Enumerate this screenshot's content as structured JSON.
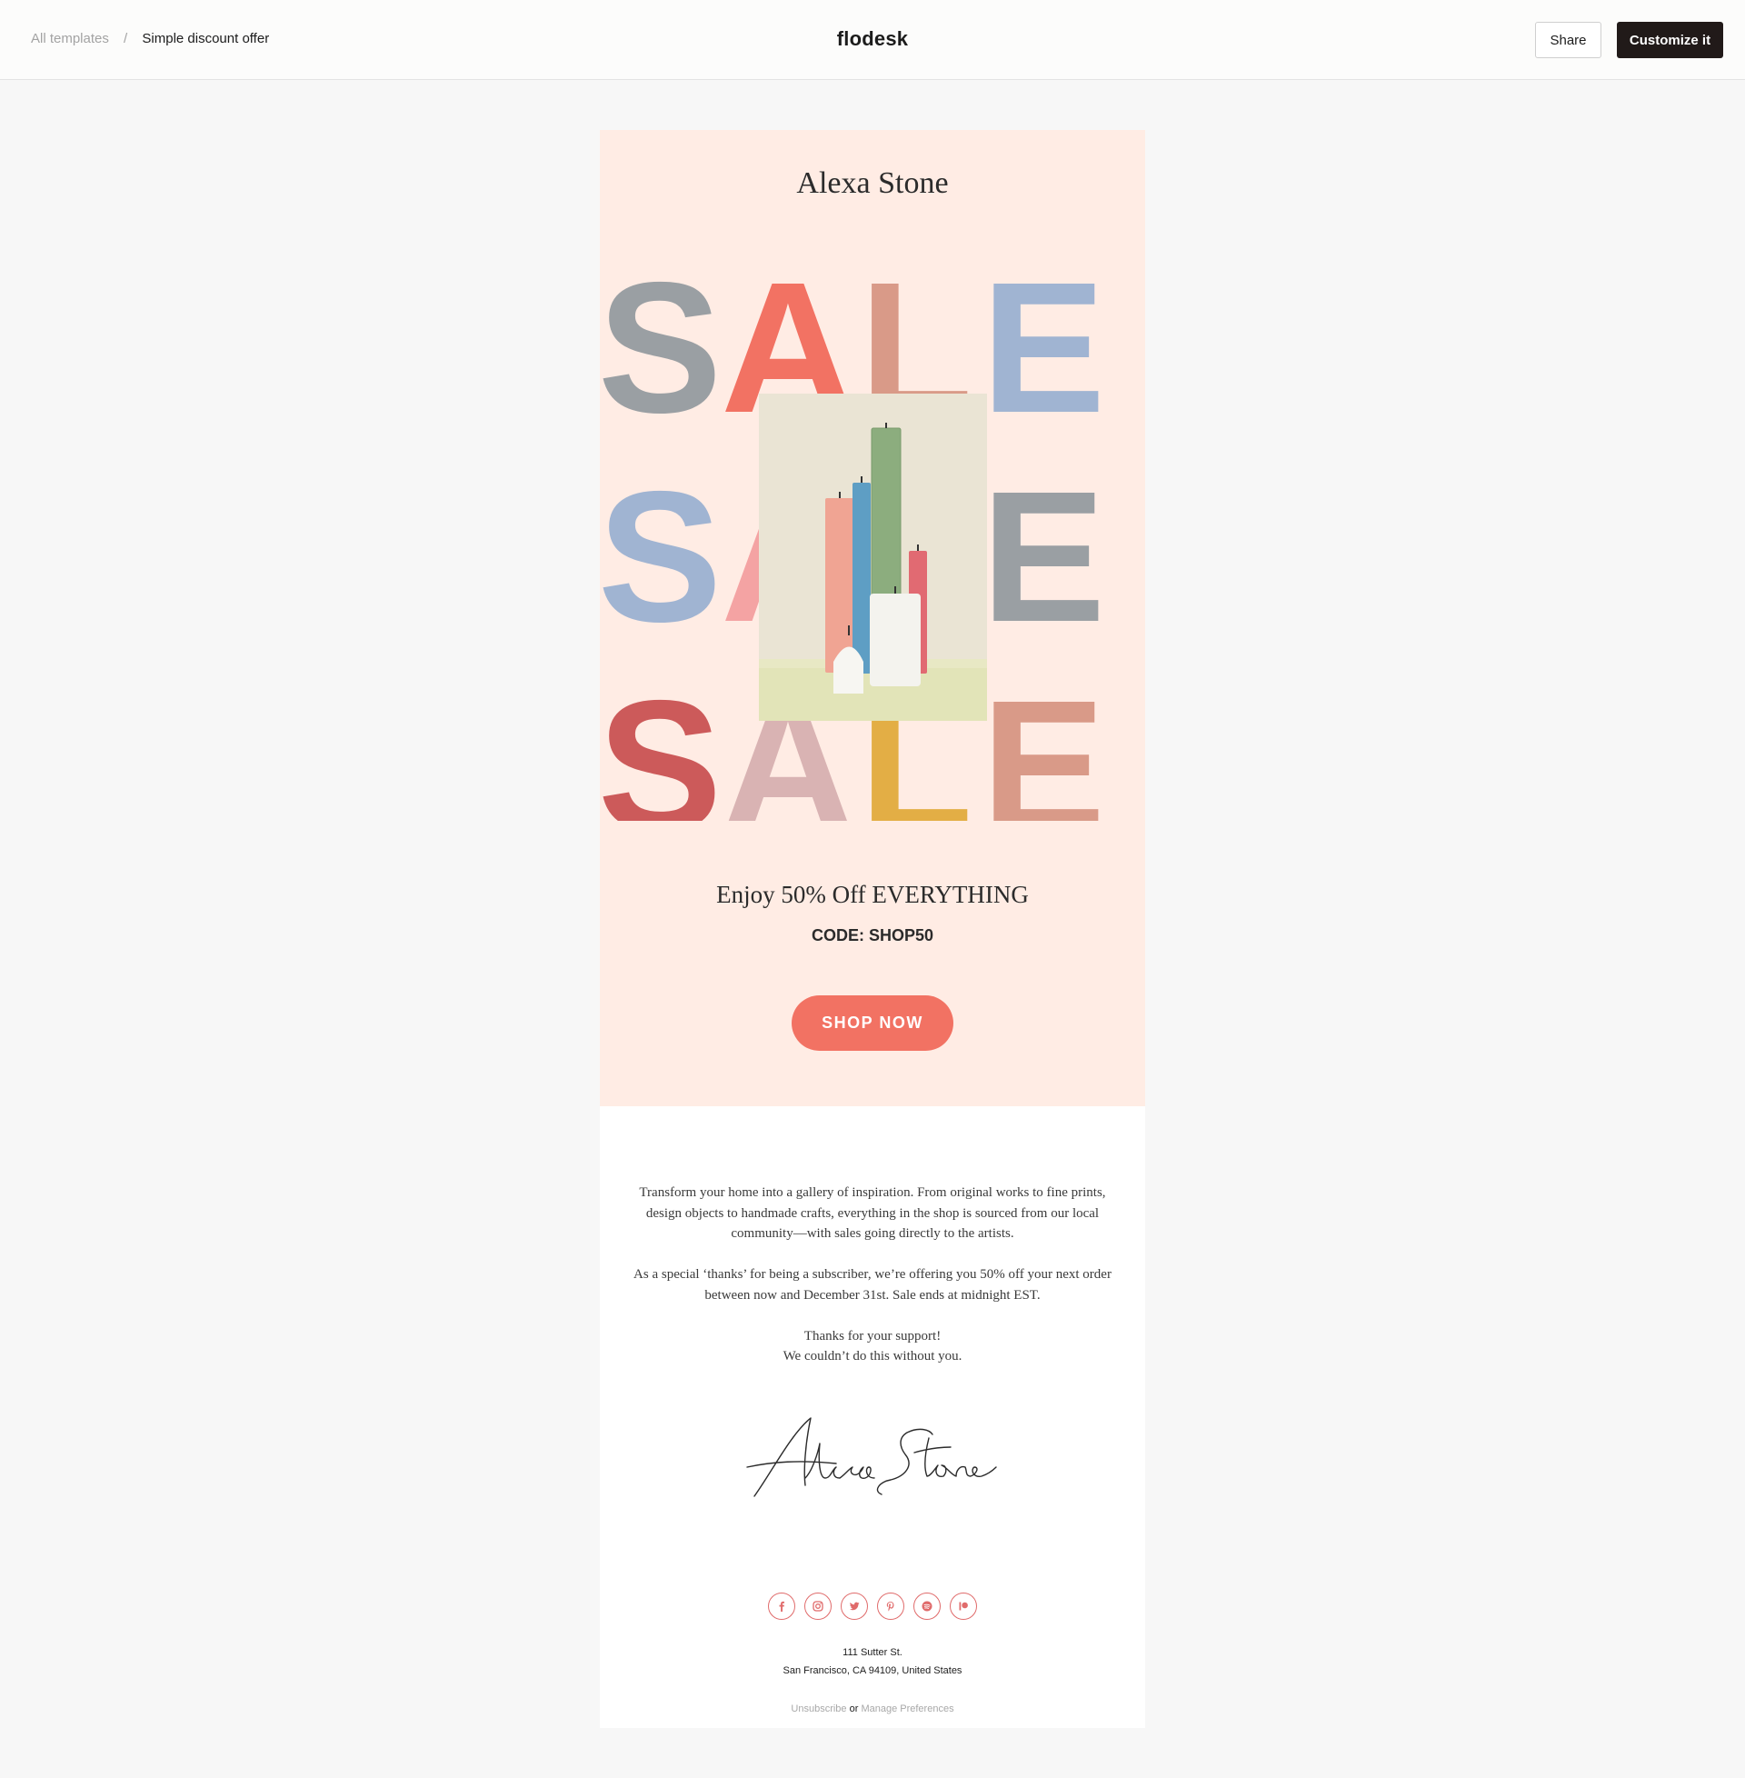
{
  "header": {
    "breadcrumb_link": "All templates",
    "breadcrumb_separator": "/",
    "breadcrumb_current": "Simple discount offer",
    "brand": "flodesk",
    "share_label": "Share",
    "customize_label": "Customize it"
  },
  "email": {
    "brand_name": "Alexa Stone",
    "sale_word": "SALE",
    "sale_rows": [
      {
        "colors": [
          "#9a9fa3",
          "#f27263",
          "#d99a88",
          "#a0b4d2"
        ]
      },
      {
        "colors": [
          "#a0b4d2",
          "#f4a3a3",
          "#f4a3a3",
          "#9a9fa3"
        ]
      },
      {
        "colors": [
          "#cc5a5a",
          "#d9b3b3",
          "#e3ae45",
          "#d99a88"
        ]
      }
    ],
    "offer_title": "Enjoy 50% Off EVERYTHING",
    "offer_code": "CODE: SHOP50",
    "cta_label": "SHOP NOW",
    "paragraphs": [
      "Transform your home into a gallery of inspiration. From original works to fine prints, design objects to handmade crafts, everything in the shop is sourced from our local community—with sales going directly to the artists.",
      "As a special ‘thanks’ for being a subscriber, we’re offering you 50% off your next order between now and December 31st. Sale ends at midnight EST.",
      "Thanks for your support!",
      "We couldn’t do this without you."
    ],
    "signature": "Alexa Stone",
    "social_icons": [
      "facebook-icon",
      "instagram-icon",
      "twitter-icon",
      "pinterest-icon",
      "spotify-icon",
      "patreon-icon"
    ],
    "address_line1": "111 Sutter St.",
    "address_line2": "San Francisco, CA 94109, United States",
    "unsubscribe": "Unsubscribe",
    "or_text": "or",
    "manage_preferences": "Manage Preferences"
  },
  "colors": {
    "accent": "#f27263",
    "hero_bg": "#ffece4",
    "page_bg": "#f7f7f7",
    "dark_button": "#211a19",
    "social_ring": "#e06b6b"
  }
}
